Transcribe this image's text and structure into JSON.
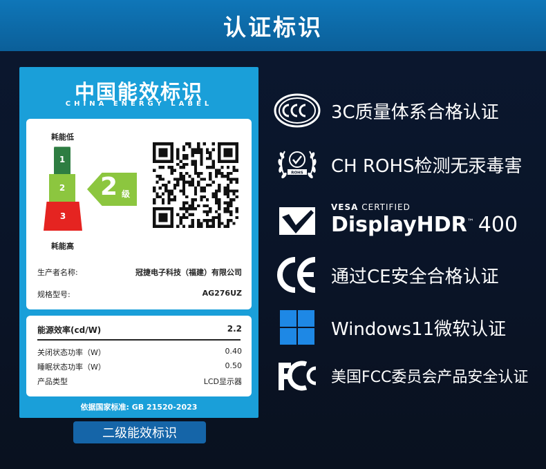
{
  "header": {
    "title": "认证标识"
  },
  "energy_label": {
    "title": "中国能效标识",
    "subtitle": "CHINA ENERGY LABEL",
    "grade_low_label": "耗能低",
    "grade_high_label": "耗能高",
    "grades": [
      "1",
      "2",
      "3"
    ],
    "current_grade": "2",
    "current_grade_unit": "级",
    "manufacturer_label": "生产者名称:",
    "manufacturer_value": "冠捷电子科技（福建）有限公司",
    "model_label": "规格型号:",
    "model_value": "AG276UZ",
    "efficiency_label": "能源效率(cd/W)",
    "efficiency_value": "2.2",
    "off_power_label": "关闭状态功率（W）",
    "off_power_value": "0.40",
    "sleep_power_label": "睡眠状态功率（W）",
    "sleep_power_value": "0.50",
    "product_type_label": "产品类型",
    "product_type_value": "LCD显示器",
    "standard": "依据国家标准: GB 21520-2023",
    "colors": {
      "background": "#1a9fd9",
      "grade1": "#2e7d42",
      "grade2": "#8cc63f",
      "grade3": "#e52421"
    }
  },
  "caption": "二级能效标识",
  "certifications": [
    {
      "icon": "ccc-icon",
      "text": "3C质量体系合格认证"
    },
    {
      "icon": "rohs-icon",
      "text": "CH ROHS检测无汞毒害"
    },
    {
      "icon": "vesa-icon",
      "top": "VESA CERTIFIED",
      "top_bold": "VESA",
      "top_rest": "CERTIFIED",
      "main": "DisplayHDR",
      "tm": "™",
      "num": "400"
    },
    {
      "icon": "ce-icon",
      "text": "通过CE安全合格认证"
    },
    {
      "icon": "windows-icon",
      "text": "Windows11微软认证"
    },
    {
      "icon": "fcc-icon",
      "text": "美国FCC委员会产品安全认证"
    }
  ]
}
